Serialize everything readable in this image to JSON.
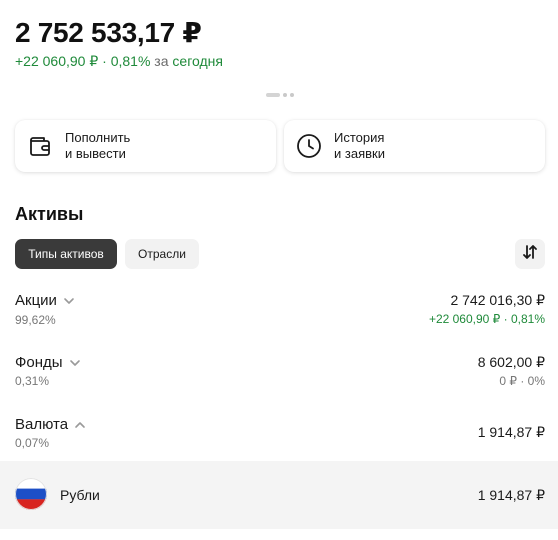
{
  "portfolio": {
    "total": "2 752 533,17 ₽",
    "change_value": "+22 060,90 ₽",
    "change_sep": " · ",
    "change_percent": "0,81%",
    "period_prefix": " за ",
    "period": "сегодня"
  },
  "actions": {
    "deposit_label": "Пополнить\nи вывести",
    "history_label": "История\nи заявки"
  },
  "assets": {
    "title": "Активы",
    "chips": {
      "types": "Типы активов",
      "industries": "Отрасли"
    },
    "rows": [
      {
        "name": "Акции",
        "share": "99,62%",
        "amount": "2 742 016,30 ₽",
        "delta": "+22 060,90 ₽ · 0,81%",
        "delta_color": "#1f8a3a",
        "expanded": false
      },
      {
        "name": "Фонды",
        "share": "0,31%",
        "amount": "8 602,00 ₽",
        "delta": "0 ₽ · 0%",
        "delta_color": "#777777",
        "expanded": false
      },
      {
        "name": "Валюта",
        "share": "0,07%",
        "amount": "1 914,87 ₽",
        "delta": "",
        "expanded": true
      }
    ],
    "currency_sub": {
      "name": "Рубли",
      "amount": "1 914,87 ₽",
      "flag_icon": "russia-flag-icon"
    }
  },
  "colors": {
    "positive": "#1f8a3a",
    "chip_active": "#3a3a3a",
    "chip_inactive": "#f2f2f2"
  }
}
